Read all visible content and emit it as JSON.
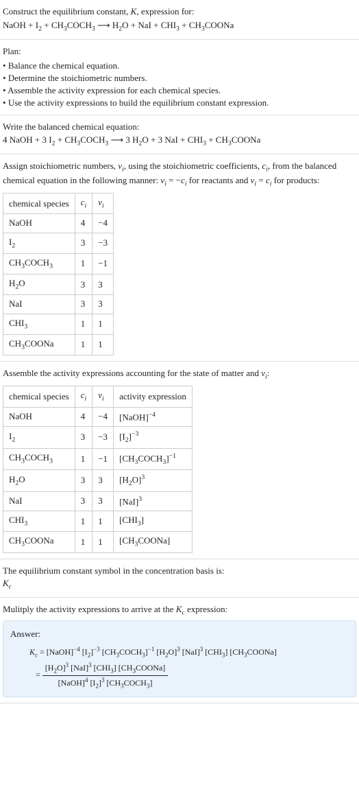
{
  "intro": {
    "line1": "Construct the equilibrium constant, K, expression for:",
    "equation": "NaOH + I₂ + CH₃COCH₃ ⟶ H₂O + NaI + CHI₃ + CH₃COONa"
  },
  "plan": {
    "heading": "Plan:",
    "items": [
      "Balance the chemical equation.",
      "Determine the stoichiometric numbers.",
      "Assemble the activity expression for each chemical species.",
      "Use the activity expressions to build the equilibrium constant expression."
    ]
  },
  "balanced": {
    "heading": "Write the balanced chemical equation:",
    "equation": "4 NaOH + 3 I₂ + CH₃COCH₃ ⟶ 3 H₂O + 3 NaI + CHI₃ + CH₃COONa"
  },
  "stoich": {
    "text": "Assign stoichiometric numbers, νᵢ, using the stoichiometric coefficients, cᵢ, from the balanced chemical equation in the following manner: νᵢ = −cᵢ for reactants and νᵢ = cᵢ for products:",
    "headers": {
      "species": "chemical species",
      "c": "cᵢ",
      "v": "νᵢ"
    },
    "rows": [
      {
        "species": "NaOH",
        "c": "4",
        "v": "−4"
      },
      {
        "species": "I₂",
        "c": "3",
        "v": "−3"
      },
      {
        "species": "CH₃COCH₃",
        "c": "1",
        "v": "−1"
      },
      {
        "species": "H₂O",
        "c": "3",
        "v": "3"
      },
      {
        "species": "NaI",
        "c": "3",
        "v": "3"
      },
      {
        "species": "CHI₃",
        "c": "1",
        "v": "1"
      },
      {
        "species": "CH₃COONa",
        "c": "1",
        "v": "1"
      }
    ]
  },
  "activity": {
    "heading": "Assemble the activity expressions accounting for the state of matter and νᵢ:",
    "headers": {
      "species": "chemical species",
      "c": "cᵢ",
      "v": "νᵢ",
      "expr": "activity expression"
    },
    "rows": [
      {
        "species": "NaOH",
        "c": "4",
        "v": "−4",
        "expr": "[NaOH]⁻⁴"
      },
      {
        "species": "I₂",
        "c": "3",
        "v": "−3",
        "expr": "[I₂]⁻³"
      },
      {
        "species": "CH₃COCH₃",
        "c": "1",
        "v": "−1",
        "expr": "[CH₃COCH₃]⁻¹"
      },
      {
        "species": "H₂O",
        "c": "3",
        "v": "3",
        "expr": "[H₂O]³"
      },
      {
        "species": "NaI",
        "c": "3",
        "v": "3",
        "expr": "[NaI]³"
      },
      {
        "species": "CHI₃",
        "c": "1",
        "v": "1",
        "expr": "[CHI₃]"
      },
      {
        "species": "CH₃COONa",
        "c": "1",
        "v": "1",
        "expr": "[CH₃COONa]"
      }
    ]
  },
  "symbol": {
    "line1": "The equilibrium constant symbol in the concentration basis is:",
    "kc": "K_c"
  },
  "multiply": {
    "heading": "Mulitply the activity expressions to arrive at the K_c expression:"
  },
  "answer": {
    "label": "Answer:",
    "line1": "K_c = [NaOH]⁻⁴ [I₂]⁻³ [CH₃COCH₃]⁻¹ [H₂O]³ [NaI]³ [CHI₃] [CH₃COONa]",
    "eq": "=",
    "num": "[H₂O]³ [NaI]³ [CHI₃] [CH₃COONa]",
    "den": "[NaOH]⁴ [I₂]³ [CH₃COCH₃]"
  }
}
